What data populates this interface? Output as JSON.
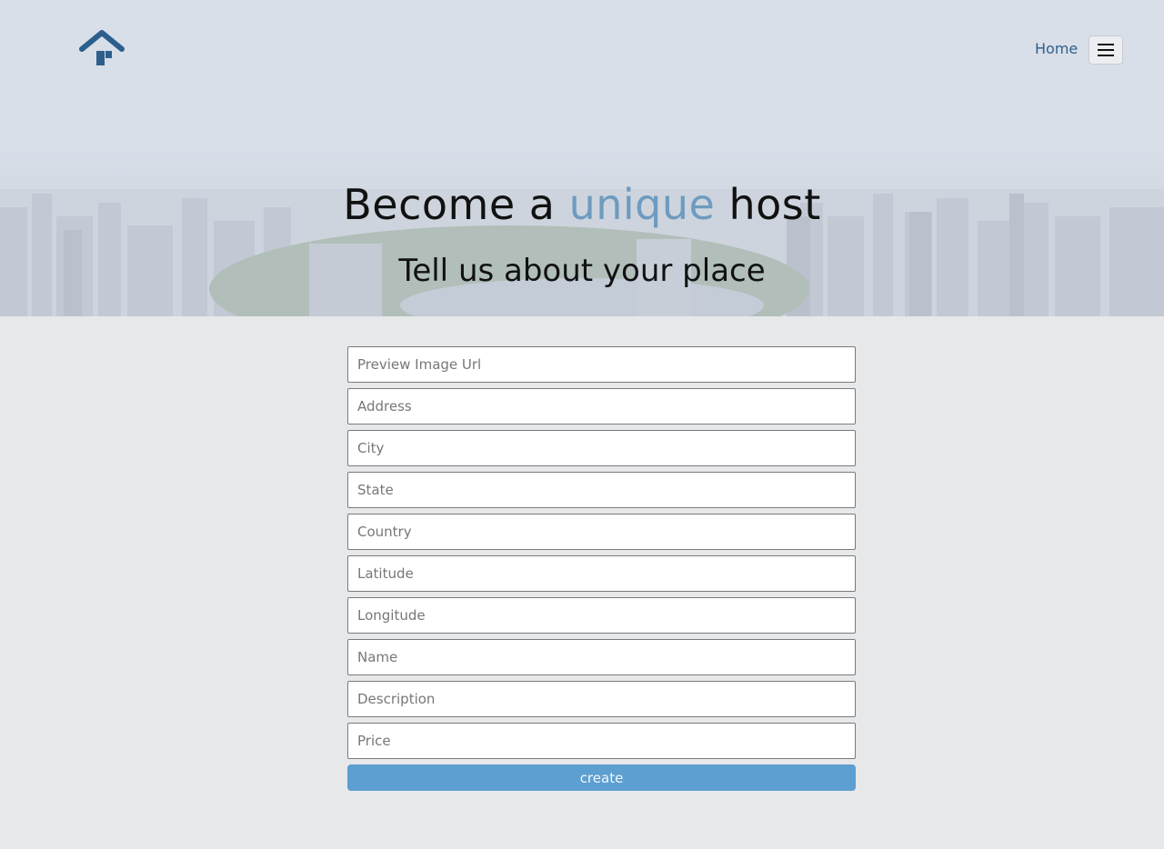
{
  "nav": {
    "home_label": "Home",
    "logo_icon": "house-icon",
    "menu_icon": "hamburger-menu-icon"
  },
  "hero": {
    "title_before": "Become a ",
    "title_accent": "unique",
    "title_after": " host",
    "subtitle": "Tell us about your place"
  },
  "form": {
    "fields": [
      {
        "placeholder": "Preview Image Url",
        "value": ""
      },
      {
        "placeholder": "Address",
        "value": ""
      },
      {
        "placeholder": "City",
        "value": ""
      },
      {
        "placeholder": "State",
        "value": ""
      },
      {
        "placeholder": "Country",
        "value": ""
      },
      {
        "placeholder": "Latitude",
        "value": ""
      },
      {
        "placeholder": "Longitude",
        "value": ""
      },
      {
        "placeholder": "Name",
        "value": ""
      },
      {
        "placeholder": "Description",
        "value": ""
      },
      {
        "placeholder": "Price",
        "value": ""
      }
    ],
    "submit_label": "create"
  },
  "colors": {
    "accent": "#6e9bbf",
    "button": "#5d9fd1",
    "logo": "#2d5f8c",
    "background": "#e7e8ea"
  }
}
